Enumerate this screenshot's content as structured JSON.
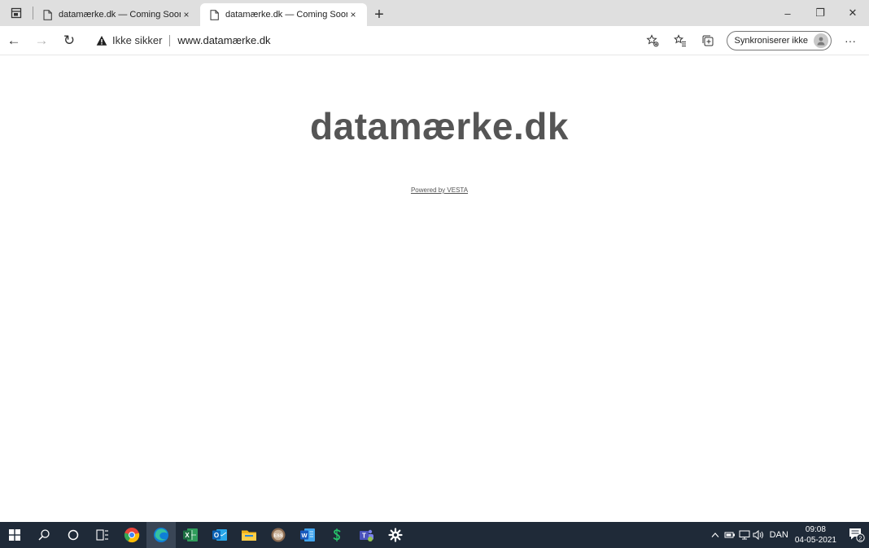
{
  "browser": {
    "tabs": [
      {
        "title": "datamærke.dk — Coming Soon",
        "active": false,
        "close": "×"
      },
      {
        "title": "datamærke.dk — Coming Soon",
        "active": true,
        "close": "×"
      }
    ],
    "newtab": "+",
    "window_controls": {
      "minimize": "–",
      "restore": "❐",
      "close": "✕"
    },
    "toolbar": {
      "back": "←",
      "forward": "→",
      "refresh": "↻",
      "not_secure": "Ikke sikker",
      "url": "www.datamærke.dk",
      "sync_label": "Synkroniserer ikke",
      "more": "···"
    }
  },
  "page": {
    "title": "datamærke.dk",
    "powered_by": "Powered by VESTA"
  },
  "taskbar": {
    "language": "DAN",
    "time": "09:08",
    "date": "04-05-2021",
    "notifications_count": "2",
    "excel_letter": "X",
    "word_letter": "W",
    "outlook_letter": "O",
    "teams_letter": "T",
    "ess_label": "ESS"
  },
  "colors": {
    "tabbar_bg": "#dfdfdf",
    "title_text": "#555555",
    "taskbar_bg": "#1f2a38"
  }
}
